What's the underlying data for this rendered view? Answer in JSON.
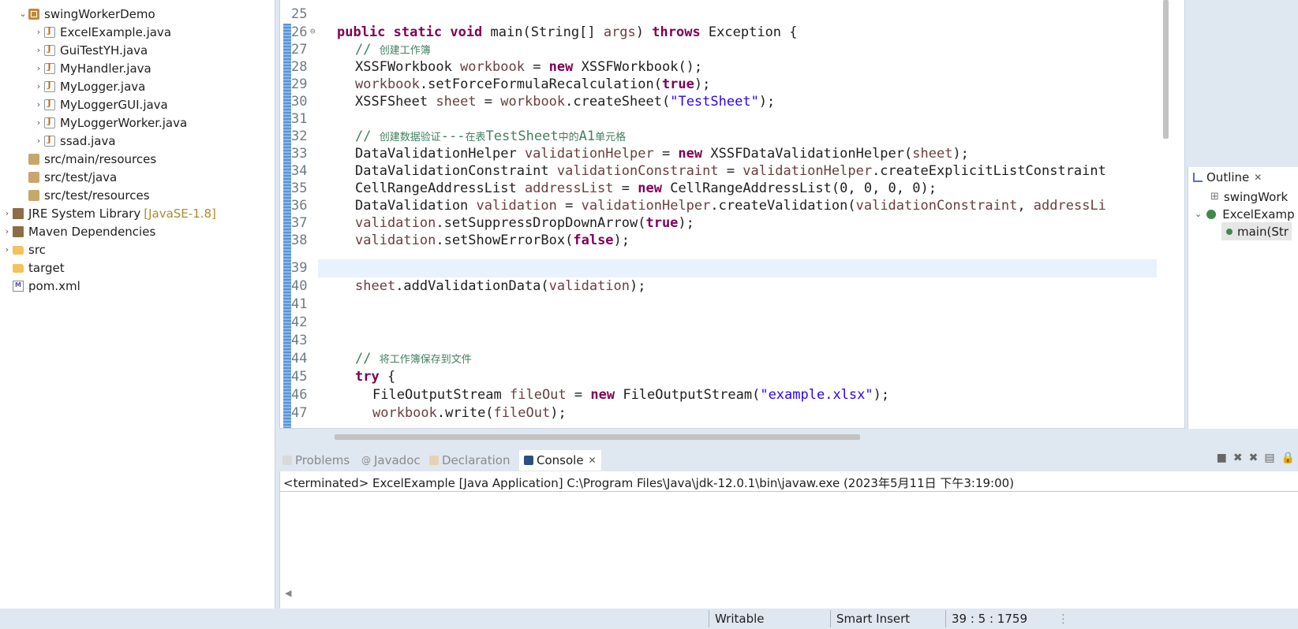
{
  "explorer": {
    "items": [
      {
        "label": "swingWorkerDemo",
        "icon": "project-icon",
        "expanded": true
      },
      {
        "label": "ExcelExample.java",
        "icon": "java-file-icon"
      },
      {
        "label": "GuiTestYH.java",
        "icon": "java-file-icon"
      },
      {
        "label": "MyHandler.java",
        "icon": "java-file-icon"
      },
      {
        "label": "MyLogger.java",
        "icon": "java-file-icon"
      },
      {
        "label": "MyLoggerGUI.java",
        "icon": "java-file-icon"
      },
      {
        "label": "MyLoggerWorker.java",
        "icon": "java-file-icon"
      },
      {
        "label": "ssad.java",
        "icon": "java-file-icon"
      },
      {
        "label": "src/main/resources",
        "icon": "source-folder-icon"
      },
      {
        "label": "src/test/java",
        "icon": "source-folder-icon"
      },
      {
        "label": "src/test/resources",
        "icon": "source-folder-icon"
      },
      {
        "label": "JRE System Library",
        "deco": "[JavaSE-1.8]",
        "icon": "library-icon"
      },
      {
        "label": "Maven Dependencies",
        "icon": "library-icon"
      },
      {
        "label": "src",
        "icon": "folder-icon"
      },
      {
        "label": "target",
        "icon": "folder-icon"
      },
      {
        "label": "pom.xml",
        "icon": "maven-pom-icon"
      }
    ]
  },
  "editor": {
    "line_numbers": [
      "25",
      "26",
      "27",
      "28",
      "29",
      "30",
      "31",
      "32",
      "33",
      "34",
      "35",
      "36",
      "37",
      "38",
      "39",
      "40",
      "41",
      "42",
      "43",
      "44",
      "45",
      "46",
      "47"
    ],
    "lines": {
      "l26": {
        "kw1": "public",
        "kw2": "static",
        "kw3": "void",
        "t1": " main(String[] ",
        "v1": "args",
        "t2": ") ",
        "kw4": "throws",
        "t3": " Exception {"
      },
      "l27": {
        "c1": "// ",
        "c2": "创建工作簿"
      },
      "l28": {
        "t1": "XSSFWorkbook ",
        "v1": "workbook",
        "t2": " = ",
        "kw1": "new",
        "t3": " XSSFWorkbook();"
      },
      "l29": {
        "v1": "workbook",
        "t1": ".setForceFormulaRecalculation(",
        "kw1": "true",
        "t2": ");"
      },
      "l30": {
        "t1": "XSSFSheet ",
        "v1": "sheet",
        "t2": " = ",
        "v2": "workbook",
        "t3": ".createSheet(",
        "s1": "\"TestSheet\"",
        "t4": ");"
      },
      "l32": {
        "c1": "// ",
        "c2": "创建数据验证",
        "c3": "---",
        "c4": "在表",
        "c5": "TestSheet",
        "c6": "中的",
        "c7": "A1",
        "c8": "单元格"
      },
      "l33": {
        "t1": "DataValidationHelper ",
        "v1": "validationHelper",
        "t2": " = ",
        "kw1": "new",
        "t3": " XSSFDataValidationHelper(",
        "v2": "sheet",
        "t4": ");"
      },
      "l34": {
        "t1": "DataValidationConstraint ",
        "v1": "validationConstraint",
        "t2": " = ",
        "v2": "validationHelper",
        "t3": ".createExplicitListConstraint"
      },
      "l35": {
        "t1": "CellRangeAddressList ",
        "v1": "addressList",
        "t2": " = ",
        "kw1": "new",
        "t3": " CellRangeAddressList(0, 0, 0, 0);"
      },
      "l36": {
        "t1": "DataValidation ",
        "v1": "validation",
        "t2": " = ",
        "v2": "validationHelper",
        "t3": ".createValidation(",
        "v3": "validationConstraint",
        "t4": ", ",
        "v4": "addressLi"
      },
      "l37": {
        "v1": "validation",
        "t1": ".setSuppressDropDownArrow(",
        "kw1": "true",
        "t2": ");"
      },
      "l38": {
        "v1": "validation",
        "t1": ".setShowErrorBox(",
        "kw1": "false",
        "t2": ");"
      },
      "l40": {
        "v1": "sheet",
        "t1": ".addValidationData(",
        "v2": "validation",
        "t2": ");"
      },
      "l44": {
        "c1": "// ",
        "c2": "将工作簿保存到文件"
      },
      "l45": {
        "kw1": "try",
        "t1": " {"
      },
      "l46": {
        "t1": "FileOutputStream ",
        "v1": "fileOut",
        "t2": " = ",
        "kw1": "new",
        "t3": " FileOutputStream(",
        "s1": "\"example.xlsx\"",
        "t4": ");"
      },
      "l47": {
        "v1": "workbook",
        "t1": ".write(",
        "v2": "fileOut",
        "t2": ");"
      }
    },
    "colors": {
      "keyword": "#7f0055",
      "variable": "#6a3e3e",
      "string": "#2a00ff",
      "comment": "#3f7f5f"
    }
  },
  "outline": {
    "tab_label": "Outline",
    "items": [
      {
        "label": "swingWork",
        "icon": "import-icon"
      },
      {
        "label": "ExcelExamp",
        "icon": "class-icon"
      },
      {
        "label": "main(Str",
        "icon": "method-icon"
      }
    ]
  },
  "console": {
    "tabs": [
      {
        "label": "Problems",
        "icon": "problems-icon"
      },
      {
        "label": "Javadoc",
        "icon": "javadoc-icon"
      },
      {
        "label": "Declaration",
        "icon": "declaration-icon"
      },
      {
        "label": "Console",
        "icon": "console-icon",
        "active": true
      }
    ],
    "status_line": "<terminated> ExcelExample [Java Application] C:\\Program Files\\Java\\jdk-12.0.1\\bin\\javaw.exe (2023年5月11日 下午3:19:00)"
  },
  "statusbar": {
    "writable": "Writable",
    "insert_mode": "Smart Insert",
    "position": "39 : 5 : 1759"
  }
}
